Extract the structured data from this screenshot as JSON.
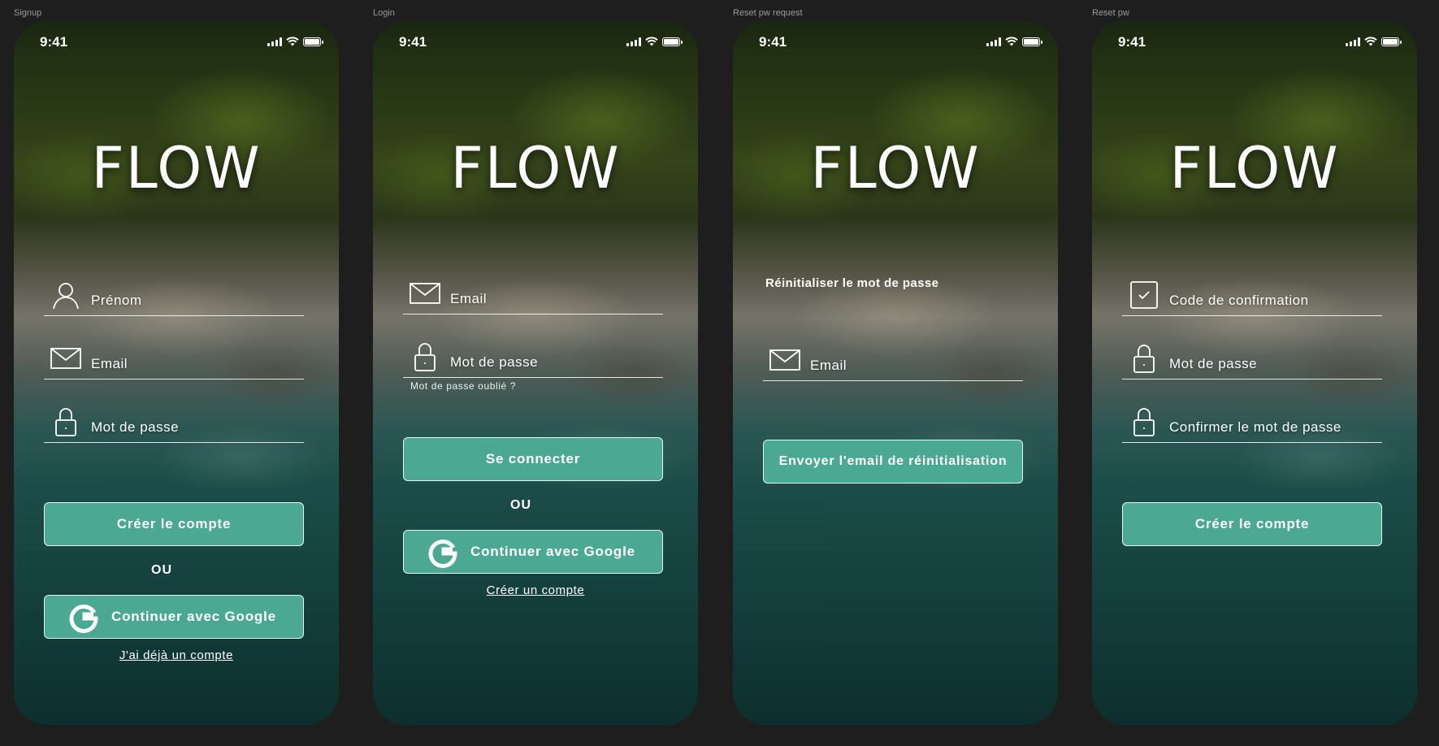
{
  "frames": [
    {
      "label": "Signup"
    },
    {
      "label": "Login"
    },
    {
      "label": "Reset pw request"
    },
    {
      "label": "Reset pw"
    }
  ],
  "status": {
    "time": "9:41"
  },
  "logo": "FLOW",
  "signup": {
    "firstname_placeholder": "Prénom",
    "email_placeholder": "Email",
    "password_placeholder": "Mot de passe",
    "create_button": "Créer le compte",
    "or_text": "OU",
    "google_button": "Continuer avec Google",
    "have_account_link": "J'ai déjà un compte"
  },
  "login": {
    "email_placeholder": "Email",
    "password_placeholder": "Mot de passe",
    "forgot_link": "Mot de passe oublié ?",
    "login_button": "Se connecter",
    "or_text": "OU",
    "google_button": "Continuer avec Google",
    "create_account_link": "Créer un compte"
  },
  "reset_request": {
    "title": "Réinitialiser le mot de passe",
    "email_placeholder": "Email",
    "send_button": "Envoyer l'email de réinitialisation"
  },
  "reset": {
    "code_placeholder": "Code de confirmation",
    "password_placeholder": "Mot de passe",
    "confirm_placeholder": "Confirmer le mot de passe",
    "create_button": "Créer le compte"
  },
  "colors": {
    "accent": "#4aa893",
    "background": "#1e1e1e"
  },
  "icons": [
    "user-icon",
    "mail-icon",
    "lock-icon",
    "check-square-icon",
    "google-icon",
    "signal-icon",
    "wifi-icon",
    "battery-icon"
  ]
}
